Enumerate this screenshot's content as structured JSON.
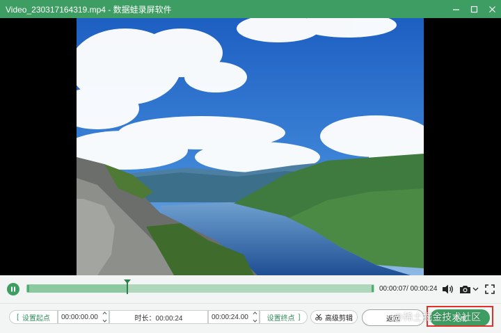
{
  "window": {
    "title": "Video_230317164319.mp4 - 数据蛙录屏软件"
  },
  "colors": {
    "accent": "#3d9d62",
    "highlight": "#e0302c"
  },
  "player": {
    "current_time": "00:00:07",
    "total_time": "/ 00:00:24",
    "playback_progress": 0.29
  },
  "toolbar": {
    "set_start_label": "设置起点",
    "start_time_value": "00:00:00.00",
    "duration_label": "时长：00:00:24",
    "end_time_value": "00:00:24.00",
    "set_end_label": "设置终点",
    "advanced_edit_label": "高级剪辑",
    "back_label": "返回",
    "done_label": "完成"
  },
  "watermark": "@稀土掘金技术社区",
  "icons": [
    "minimize-icon",
    "maximize-icon",
    "close-icon",
    "pause-icon",
    "volume-icon",
    "camera-icon",
    "chevron-down-icon",
    "fullscreen-icon",
    "scissors-icon"
  ]
}
